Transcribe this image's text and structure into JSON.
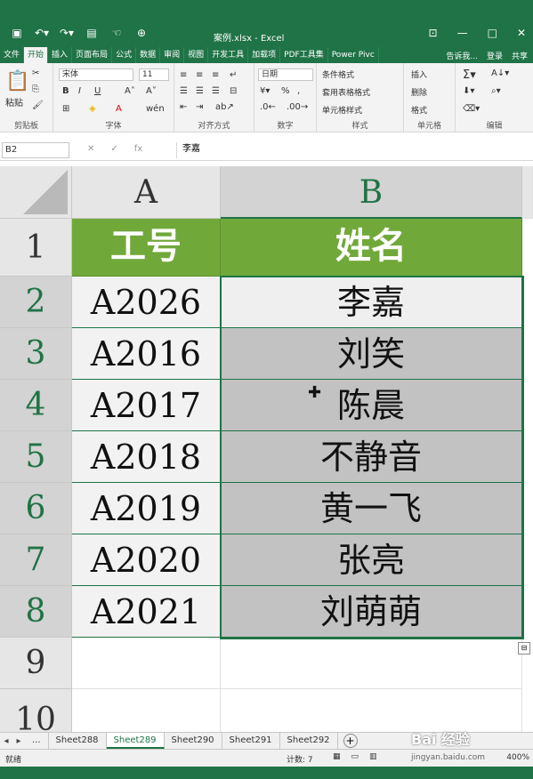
{
  "window": {
    "title": "案例.xlsx - Excel",
    "qat": [
      "save-icon",
      "undo-icon",
      "redo-icon",
      "form-icon",
      "touch-icon",
      "zoom-icon"
    ],
    "controls": [
      "restore-ribbon-icon",
      "minimize-icon",
      "maximize-icon",
      "close-icon"
    ]
  },
  "tabs": [
    "文件",
    "开始",
    "插入",
    "页面布局",
    "公式",
    "数据",
    "审阅",
    "视图",
    "开发工具",
    "加载项",
    "PDF工具集",
    "Power Pivc"
  ],
  "active_tab": "开始",
  "tabs_right": {
    "tell": "告诉我...",
    "login": "登录",
    "share": "共享"
  },
  "ribbon": {
    "paste_label": "粘贴",
    "font_name": "宋体",
    "font_size": "11",
    "number_format": "日期",
    "styles": [
      "条件格式",
      "套用表格格式",
      "单元格样式"
    ],
    "cells": [
      "插入",
      "删除",
      "格式"
    ],
    "groups": {
      "clipboard": "剪贴板",
      "font": "字体",
      "align": "对齐方式",
      "number": "数字",
      "styles": "样式",
      "cells": "单元格",
      "editing": "编辑"
    }
  },
  "formula_bar": {
    "namebox": "B2",
    "fx": "fx",
    "value": "李嘉"
  },
  "grid": {
    "col_headers": [
      "A",
      "B"
    ],
    "row_headers": [
      "1",
      "2",
      "3",
      "4",
      "5",
      "6",
      "7",
      "8",
      "9",
      "10"
    ],
    "header_row": [
      "工号",
      "姓名"
    ],
    "rows": [
      [
        "A2026",
        "李嘉"
      ],
      [
        "A2016",
        "刘笑"
      ],
      [
        "A2017",
        "陈晨"
      ],
      [
        "A2018",
        "不静音"
      ],
      [
        "A2019",
        "黄一飞"
      ],
      [
        "A2020",
        "张亮"
      ],
      [
        "A2021",
        "刘萌萌"
      ]
    ],
    "active_cell": "B2",
    "colors": {
      "header_fill": "#71a83a",
      "selection": "#c2c2c2",
      "accent": "#1f7346"
    }
  },
  "sheets": {
    "tabs": [
      "Sheet288",
      "Sheet289",
      "Sheet290",
      "Sheet291",
      "Sheet292"
    ],
    "active": "Sheet289",
    "more": "..."
  },
  "status": {
    "ready": "就绪",
    "count": "计数: 7",
    "zoom": "400%"
  },
  "watermark": "Bai 经验",
  "watermark_url": "jingyan.baidu.com"
}
